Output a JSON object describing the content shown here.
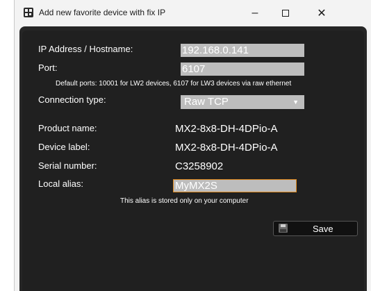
{
  "window": {
    "title": "Add new favorite device with fix IP",
    "controls": {
      "minimize": "–",
      "close": "✕"
    }
  },
  "form": {
    "ip_label": "IP Address / Hostname:",
    "ip_value": "192.168.0.141",
    "port_label": "Port:",
    "port_value": "6107",
    "port_hint": "Default ports: 10001 for LW2 devices, 6107 for LW3 devices via raw ethernet",
    "connection_label": "Connection type:",
    "connection_value": "Raw TCP",
    "product_label": "Product name:",
    "product_value": "MX2-8x8-DH-4DPio-A",
    "device_label_label": "Device label:",
    "device_label_value": "MX2-8x8-DH-4DPio-A",
    "serial_label": "Serial number:",
    "serial_value": "C3258902",
    "alias_label": "Local alias:",
    "alias_value": "MyMX2S",
    "alias_hint": "This alias is stored only on your computer",
    "save_label": "Save"
  },
  "colors": {
    "dialog_bg": "#202020",
    "field_bg": "#bdbdbd",
    "alias_border": "#e08a1e"
  },
  "icons": [
    "app-icon",
    "minimize-icon",
    "maximize-icon",
    "close-icon",
    "floppy-disk-icon",
    "dropdown-arrow-icon"
  ]
}
